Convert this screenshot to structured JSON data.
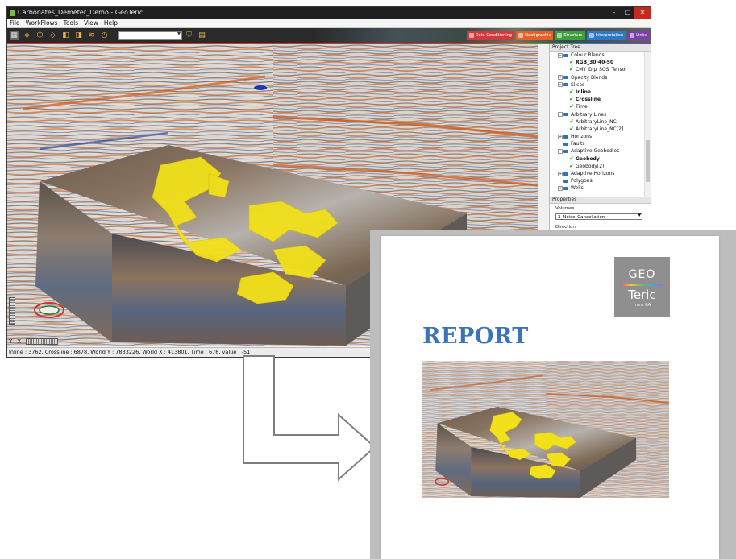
{
  "window": {
    "title": "Carbonates_Demeter_Demo - GeoTeric",
    "controls": {
      "minimize": "–",
      "maximize": "□",
      "close": "✕"
    }
  },
  "menu": [
    "File",
    "WorkFlows",
    "Tools",
    "View",
    "Help"
  ],
  "workflow_tabs": [
    {
      "label": "Data Conditioning",
      "color": "#d13b3b"
    },
    {
      "label": "Stratigraphic",
      "color": "#e4622a"
    },
    {
      "label": "Structure",
      "color": "#3f9e3f"
    },
    {
      "label": "Interpretation",
      "color": "#2c79c7"
    },
    {
      "label": "Links",
      "color": "#7d3fa9"
    }
  ],
  "viewport": {
    "axis_y": "Y",
    "axis_x": "X"
  },
  "status": "Inline : 3762, Crossline : 6878, World Y : 7833226, World X : 413801, Time : 676, value : -51",
  "project_tree": {
    "header": "Project Tree",
    "items": [
      {
        "label": "Colour Blends",
        "level": 1,
        "kind": "folder",
        "exp": "−"
      },
      {
        "label": "RGB_30-40-50",
        "level": 2,
        "kind": "check",
        "bold": true
      },
      {
        "label": "CMY_Dip_SOS_Tensor",
        "level": 2,
        "kind": "check",
        "bold": false
      },
      {
        "label": "Opacity Blends",
        "level": 1,
        "kind": "folder",
        "exp": "+"
      },
      {
        "label": "Slices",
        "level": 1,
        "kind": "folder",
        "exp": "−"
      },
      {
        "label": "Inline",
        "level": 2,
        "kind": "check",
        "bold": true
      },
      {
        "label": "Crossline",
        "level": 2,
        "kind": "check",
        "bold": true
      },
      {
        "label": "Time",
        "level": 2,
        "kind": "check",
        "bold": false
      },
      {
        "label": "Arbitrary Lines",
        "level": 1,
        "kind": "folder",
        "exp": "−"
      },
      {
        "label": "ArbitraryLine_NC",
        "level": 2,
        "kind": "check",
        "bold": false
      },
      {
        "label": "ArbitraryLine_NC[2]",
        "level": 2,
        "kind": "check",
        "bold": false
      },
      {
        "label": "Horizons",
        "level": 1,
        "kind": "folder",
        "exp": "+"
      },
      {
        "label": "Faults",
        "level": 1,
        "kind": "folder",
        "exp": ""
      },
      {
        "label": "Adaptive Geobodies",
        "level": 1,
        "kind": "folder",
        "exp": "−"
      },
      {
        "label": "Geobody",
        "level": 2,
        "kind": "check",
        "bold": true
      },
      {
        "label": "Geobody[2]",
        "level": 2,
        "kind": "check",
        "bold": false
      },
      {
        "label": "Adaptive Horizons",
        "level": 1,
        "kind": "folder",
        "exp": "+"
      },
      {
        "label": "Polygons",
        "level": 1,
        "kind": "folder",
        "exp": ""
      },
      {
        "label": "Wells",
        "level": 1,
        "kind": "folder",
        "exp": "+"
      }
    ]
  },
  "properties": {
    "header": "Properties",
    "volumes_label": "Volumes",
    "volumes_value": "3_Noise_Cancellation",
    "direction_label": "Direction"
  },
  "report": {
    "title": "REPORT",
    "logo_top": "GEO",
    "logo_main": "Teric",
    "logo_sub": "from RA"
  }
}
